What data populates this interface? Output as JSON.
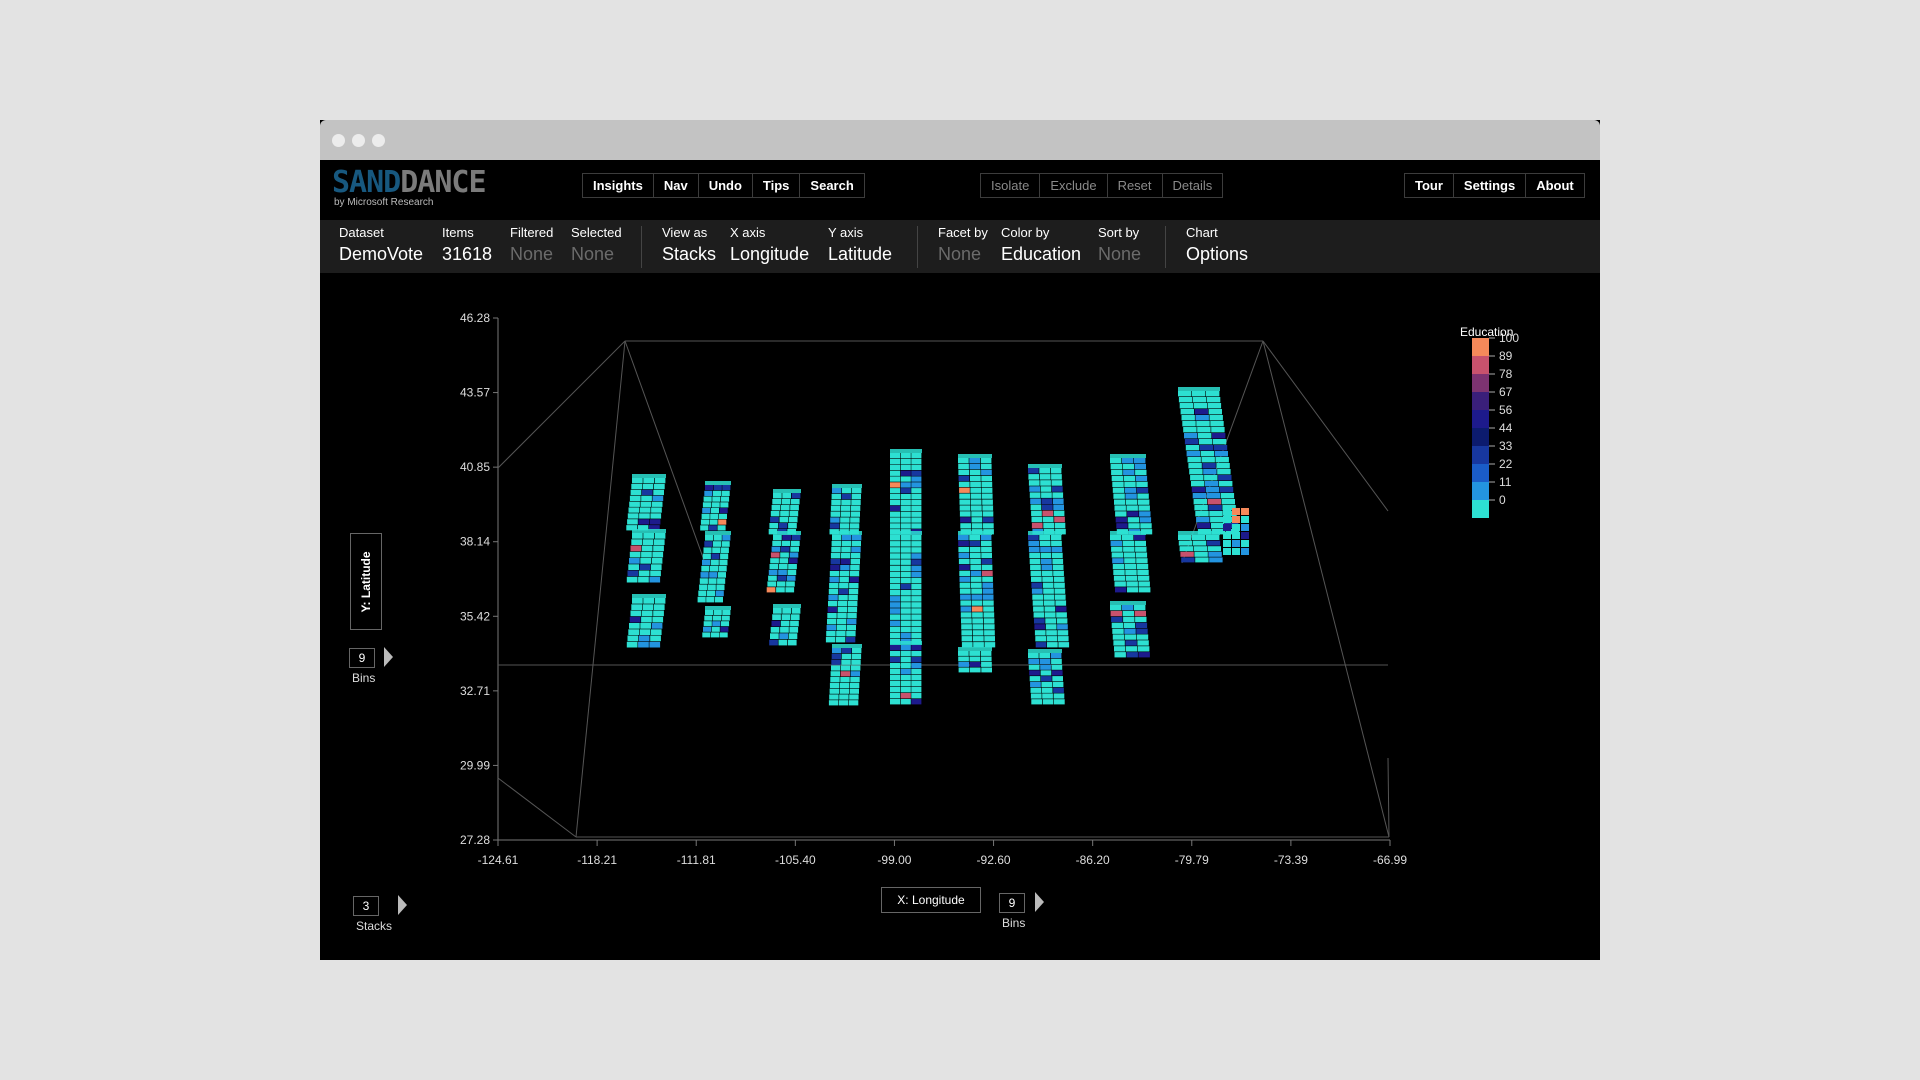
{
  "window": {
    "logo": {
      "sand": "SAND",
      "dance": "DANCE",
      "sub": "by Microsoft Research"
    }
  },
  "toolbar": {
    "left": [
      "Insights",
      "Nav",
      "Undo",
      "Tips",
      "Search"
    ],
    "middle": [
      "Isolate",
      "Exclude",
      "Reset",
      "Details"
    ],
    "right": [
      "Tour",
      "Settings",
      "About"
    ]
  },
  "infobar": {
    "dataset": {
      "label": "Dataset",
      "value": "DemoVote"
    },
    "items": {
      "label": "Items",
      "value": "31618"
    },
    "filtered": {
      "label": "Filtered",
      "value": "None"
    },
    "selected": {
      "label": "Selected",
      "value": "None"
    },
    "view_as": {
      "label": "View as",
      "value": "Stacks"
    },
    "x_axis": {
      "label": "X axis",
      "value": "Longitude"
    },
    "y_axis": {
      "label": "Y axis",
      "value": "Latitude"
    },
    "facet_by": {
      "label": "Facet by",
      "value": "None"
    },
    "color_by": {
      "label": "Color by",
      "value": "Education"
    },
    "sort_by": {
      "label": "Sort by",
      "value": "None"
    },
    "chart": {
      "label": "Chart",
      "value": "Options"
    }
  },
  "controls": {
    "y_axis_button": "Y: Latitude",
    "y_bins": {
      "value": "9",
      "label": "Bins"
    },
    "stacks": {
      "value": "3",
      "label": "Stacks"
    },
    "x_axis_button": "X: Longitude",
    "x_bins": {
      "value": "9",
      "label": "Bins"
    }
  },
  "chart_data": {
    "type": "3d-stacked-bins",
    "y_ticks": [
      "46.28",
      "43.57",
      "40.85",
      "38.14",
      "35.42",
      "32.71",
      "29.99",
      "27.28"
    ],
    "x_ticks": [
      "-124.61",
      "-118.21",
      "-111.81",
      "-105.40",
      "-99.00",
      "-92.60",
      "-86.20",
      "-79.79",
      "-73.39",
      "-66.99"
    ],
    "legend": {
      "title": "Education",
      "labels": [
        "100",
        "89",
        "78",
        "67",
        "56",
        "44",
        "33",
        "22",
        "11",
        "0"
      ],
      "colors": [
        "#f6895a",
        "#c8526d",
        "#7d3371",
        "#3a1f7a",
        "#1d1a8c",
        "#0c1b6e",
        "#17379f",
        "#1a5cc8",
        "#2394e0",
        "#2de0d2"
      ]
    },
    "palette": {
      "base": "#2de0d2",
      "light": "#2394e0",
      "mid": "#17379f",
      "dark": "#1d1a8c",
      "hot": "#f6895a",
      "warm": "#c8526d"
    }
  }
}
